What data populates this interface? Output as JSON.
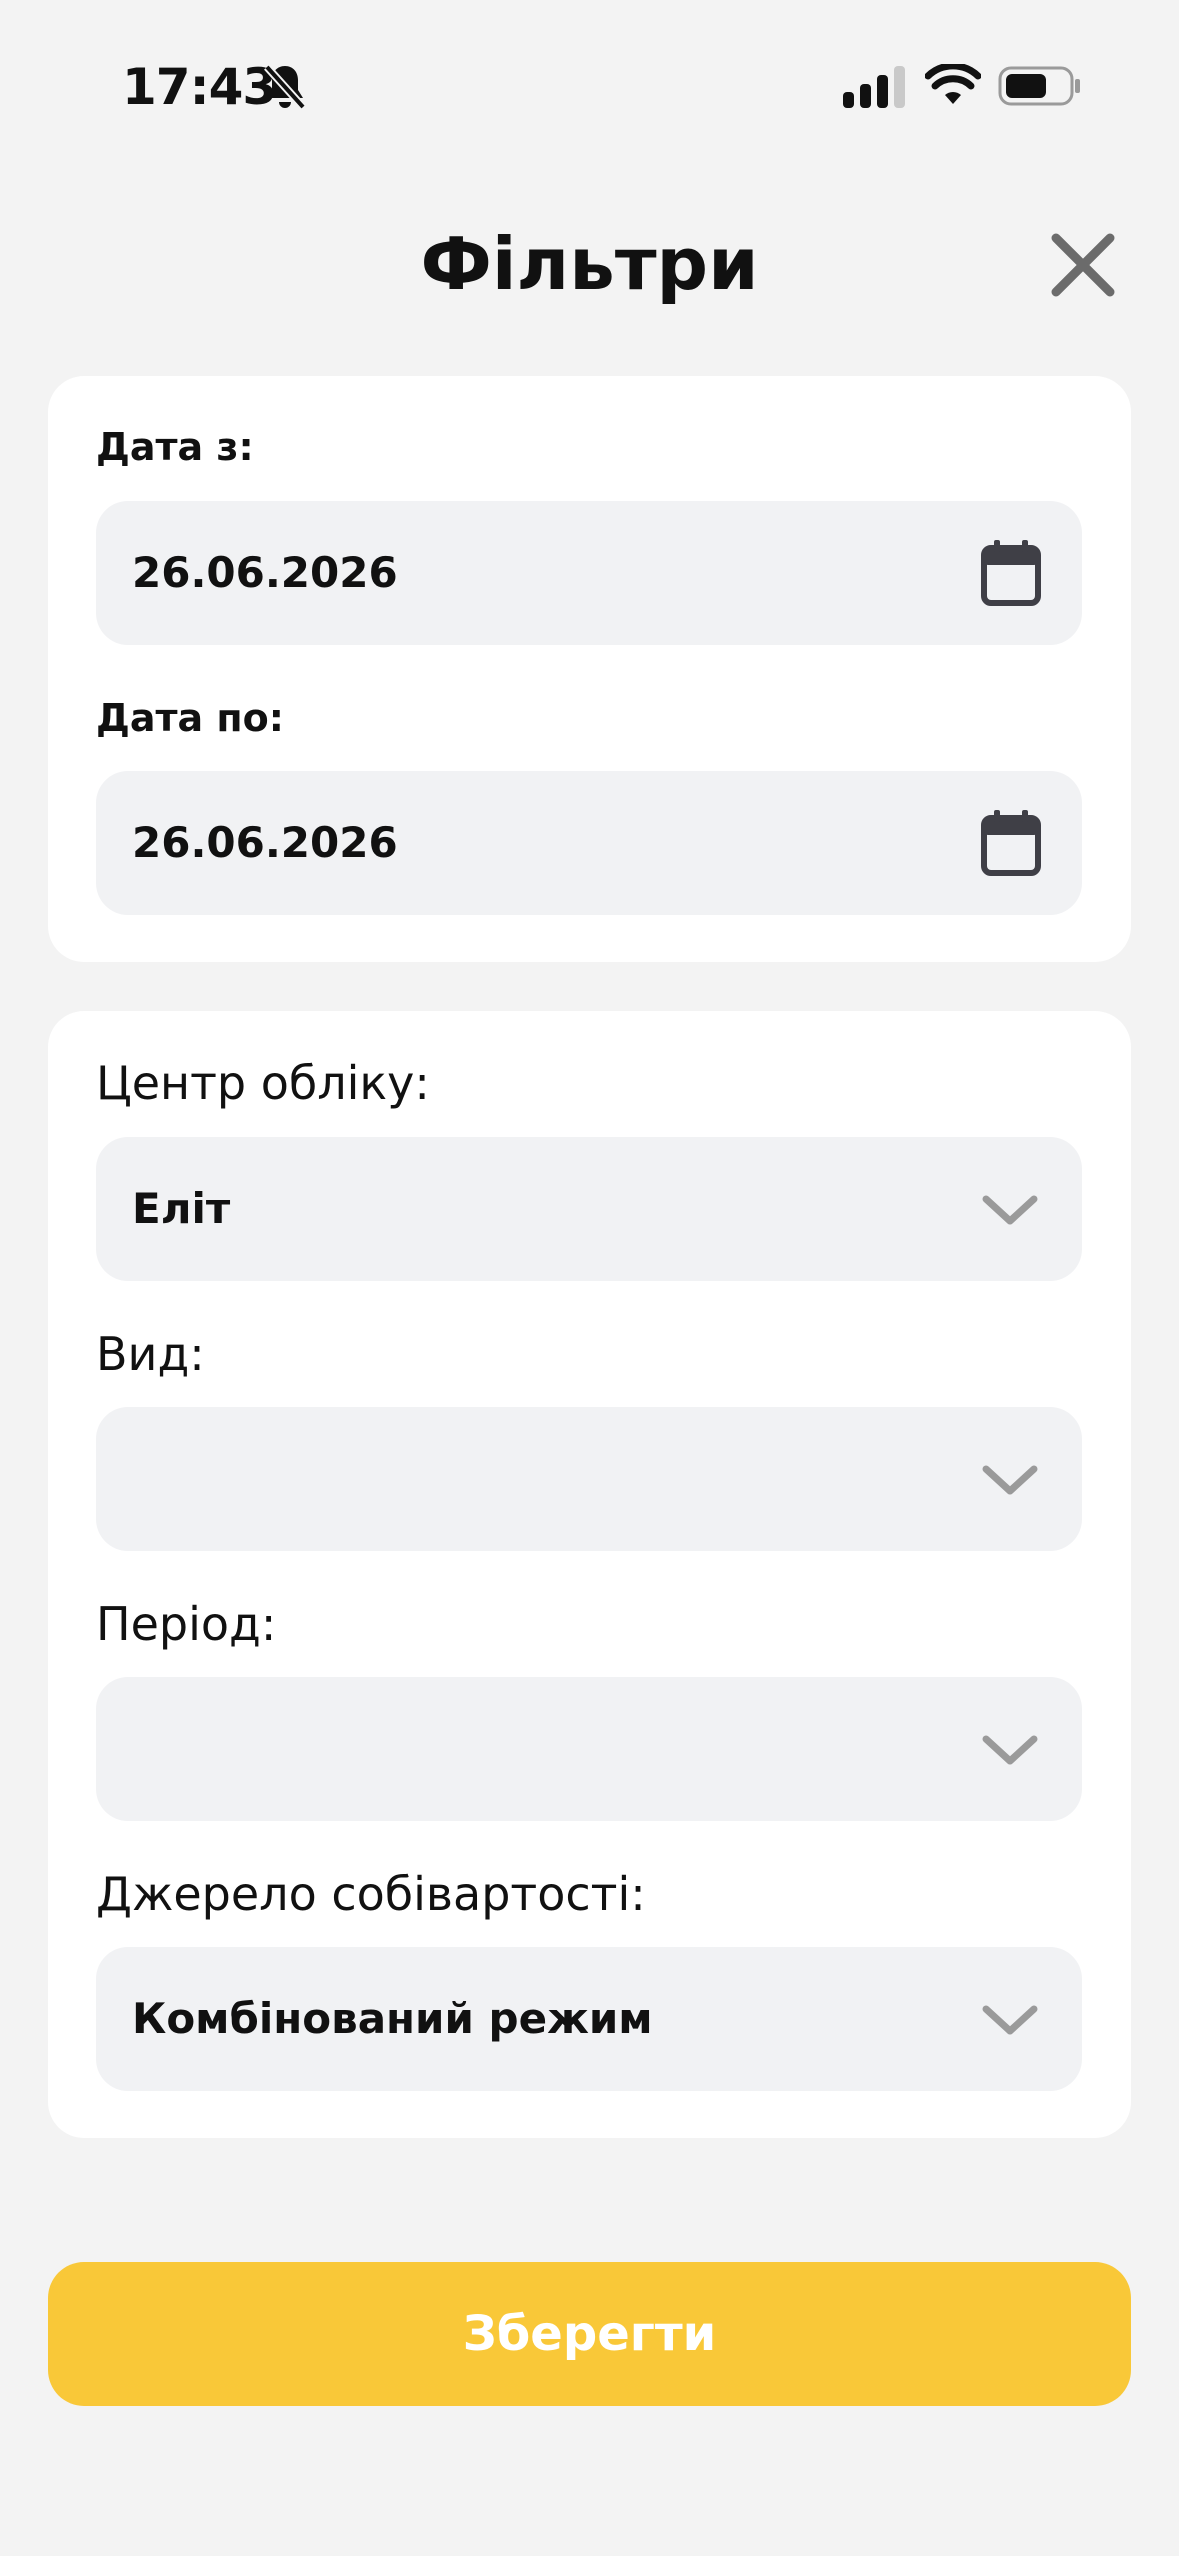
{
  "status_bar": {
    "time": "17:43",
    "icons": [
      "bell-slash-icon",
      "cellular-signal-icon",
      "wifi-icon",
      "battery-icon"
    ]
  },
  "header": {
    "title": "Фільтри",
    "close_icon": "close-icon"
  },
  "dates": {
    "from_label": "Дата з:",
    "from_value": "26.06.2026",
    "to_label": "Дата по:",
    "to_value": "26.06.2026",
    "icon": "calendar-icon"
  },
  "filters": {
    "center_label": "Центр обліку:",
    "center_value": "Еліт",
    "type_label": "Вид:",
    "type_value": "",
    "period_label": "Період:",
    "period_value": "",
    "cost_source_label": "Джерело собівартості:",
    "cost_source_value": "Комбінований режим",
    "icon": "chevron-down-icon"
  },
  "actions": {
    "save_label": "Зберегти"
  },
  "colors": {
    "background": "#f3f3f3",
    "card": "#ffffff",
    "field": "#f1f2f4",
    "accent": "#f9c838",
    "icon_gray": "#9a9a9a",
    "calendar": "#3f3f46"
  }
}
